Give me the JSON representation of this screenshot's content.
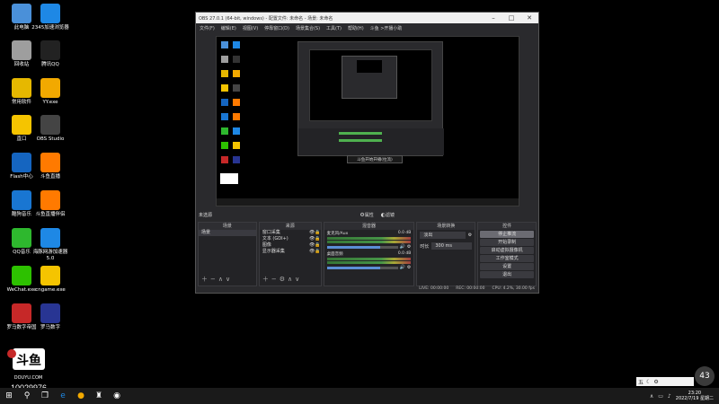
{
  "desktop": {
    "icons": [
      {
        "label": "此电脑",
        "color": "#4a90d9"
      },
      {
        "label": "2345加速浏览器",
        "color": "#1e88e5"
      },
      {
        "label": "回收站",
        "color": "#9e9e9e"
      },
      {
        "label": "腾讯QQ",
        "color": "#222222"
      },
      {
        "label": "常用软件",
        "color": "#e6b800"
      },
      {
        "label": "YY.exe",
        "color": "#f2a900"
      },
      {
        "label": "直口",
        "color": "#f5c400"
      },
      {
        "label": "OBS Studio",
        "color": "#444444"
      },
      {
        "label": "Flash中心",
        "color": "#1565c0"
      },
      {
        "label": "斗鱼直播",
        "color": "#ff7a00"
      },
      {
        "label": "酷狗音乐",
        "color": "#1976d2"
      },
      {
        "label": "斗鱼直播伴侣",
        "color": "#ff7a00"
      },
      {
        "label": "QQ音乐",
        "color": "#2eb82e"
      },
      {
        "label": "海豚网游加速器5.0",
        "color": "#1e88e5"
      },
      {
        "label": "WeChat.exe",
        "color": "#2dc100"
      },
      {
        "label": "cngame.exe",
        "color": "#f5c400"
      },
      {
        "label": "罗马数字帝国",
        "color": "#c62828"
      },
      {
        "label": "罗马数字",
        "color": "#283593"
      }
    ],
    "room_id": "10029976",
    "logo_text": "DOUYU.COM",
    "float_badge": "43"
  },
  "obs": {
    "title": "OBS 27.0.1 (64-bit, windows) - 配置文件: 未命名 - 场景: 未命名",
    "menu": [
      "文件(F)",
      "编辑(E)",
      "视图(V)",
      "停靠窗口(D)",
      "场景集合(S)",
      "工具(T)",
      "帮助(H)",
      "斗鱼 >开播小助"
    ],
    "below_preview": {
      "left": "未选源",
      "props": "属性",
      "filters": "滤镜"
    },
    "scenes": {
      "header": "场景",
      "items": [
        "场景"
      ]
    },
    "sources": {
      "header": "来源",
      "items": [
        "窗口采集",
        "文本 (GDI+)",
        "图像",
        "显示器采集"
      ]
    },
    "mixer": {
      "header": "混音器",
      "channels": [
        {
          "name": "麦克风/Aux",
          "db": "0.0 dB"
        },
        {
          "name": "桌面音频",
          "db": "0.0 dB"
        }
      ]
    },
    "transitions": {
      "header": "场景转换",
      "type": "淡出",
      "duration_label": "时长",
      "duration": "300 ms"
    },
    "controls": {
      "header": "控件",
      "buttons": [
        "停止推流",
        "开始录制",
        "启动虚拟摄像机",
        "工作室模式",
        "设置",
        "退出"
      ]
    },
    "status": {
      "live": "LIVE: 00:00:00",
      "rec": "REC: 00:00:00",
      "cpu": "CPU: 4.2%, 30.00 fps"
    },
    "nested_popup": "斗鱼开始开播(拉流)"
  },
  "taskbar": {
    "clock_time": "23:20",
    "clock_date": "2022/7/19 星期二",
    "ime": "五"
  }
}
